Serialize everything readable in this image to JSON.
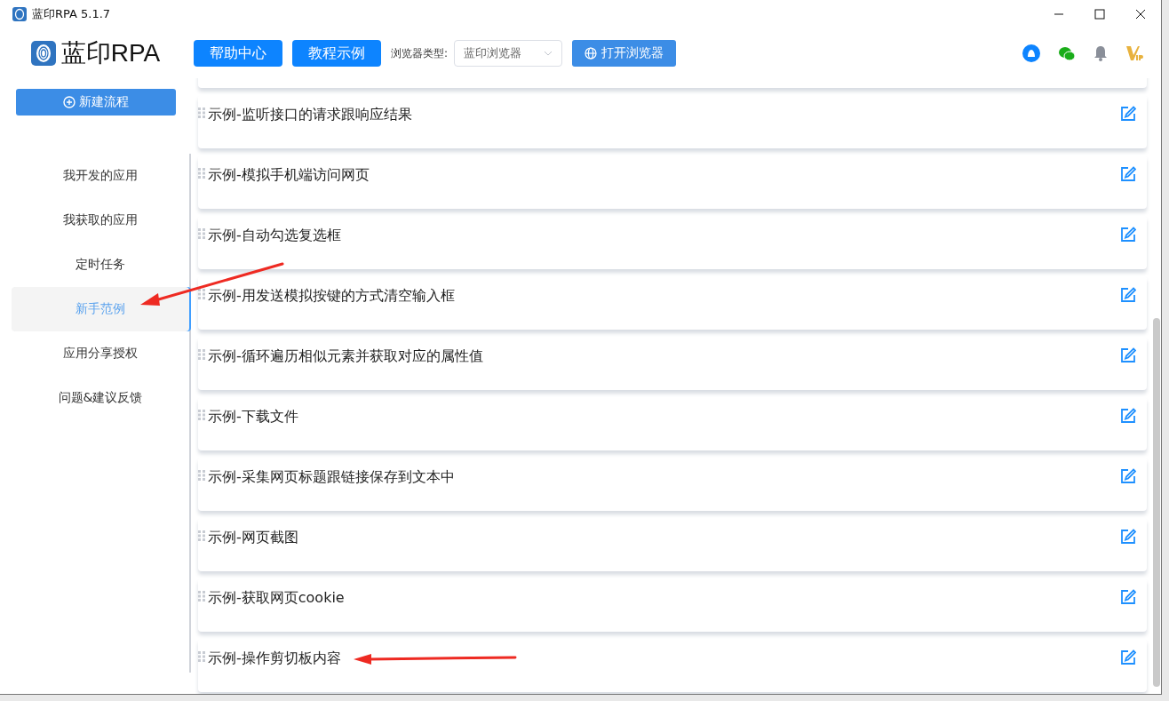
{
  "window": {
    "title": "蓝印RPA 5.1.7"
  },
  "logo": {
    "text": "蓝印RPA"
  },
  "header": {
    "buttons": [
      "帮助中心",
      "教程示例"
    ],
    "browser_label": "浏览器类型:",
    "browser_select": {
      "value": "蓝印浏览器"
    },
    "open_browser": "打开浏览器"
  },
  "sidebar": {
    "new_flow": "新建流程",
    "items": [
      {
        "label": "我开发的应用",
        "selected": false
      },
      {
        "label": "我获取的应用",
        "selected": false
      },
      {
        "label": "定时任务",
        "selected": false
      },
      {
        "label": "新手范例",
        "selected": true
      },
      {
        "label": "应用分享授权",
        "selected": false
      },
      {
        "label": "问题&建议反馈",
        "selected": false
      }
    ]
  },
  "examples": [
    {
      "title": "示例-监听接口的请求跟响应结果"
    },
    {
      "title": "示例-模拟手机端访问网页"
    },
    {
      "title": "示例-自动勾选复选框"
    },
    {
      "title": "示例-用发送模拟按键的方式清空输入框"
    },
    {
      "title": "示例-循环遍历相似元素并获取对应的属性值"
    },
    {
      "title": "示例-下载文件"
    },
    {
      "title": "示例-采集网页标题跟链接保存到文本中"
    },
    {
      "title": "示例-网页截图"
    },
    {
      "title": "示例-获取网页cookie"
    },
    {
      "title": "示例-操作剪切板内容"
    }
  ]
}
